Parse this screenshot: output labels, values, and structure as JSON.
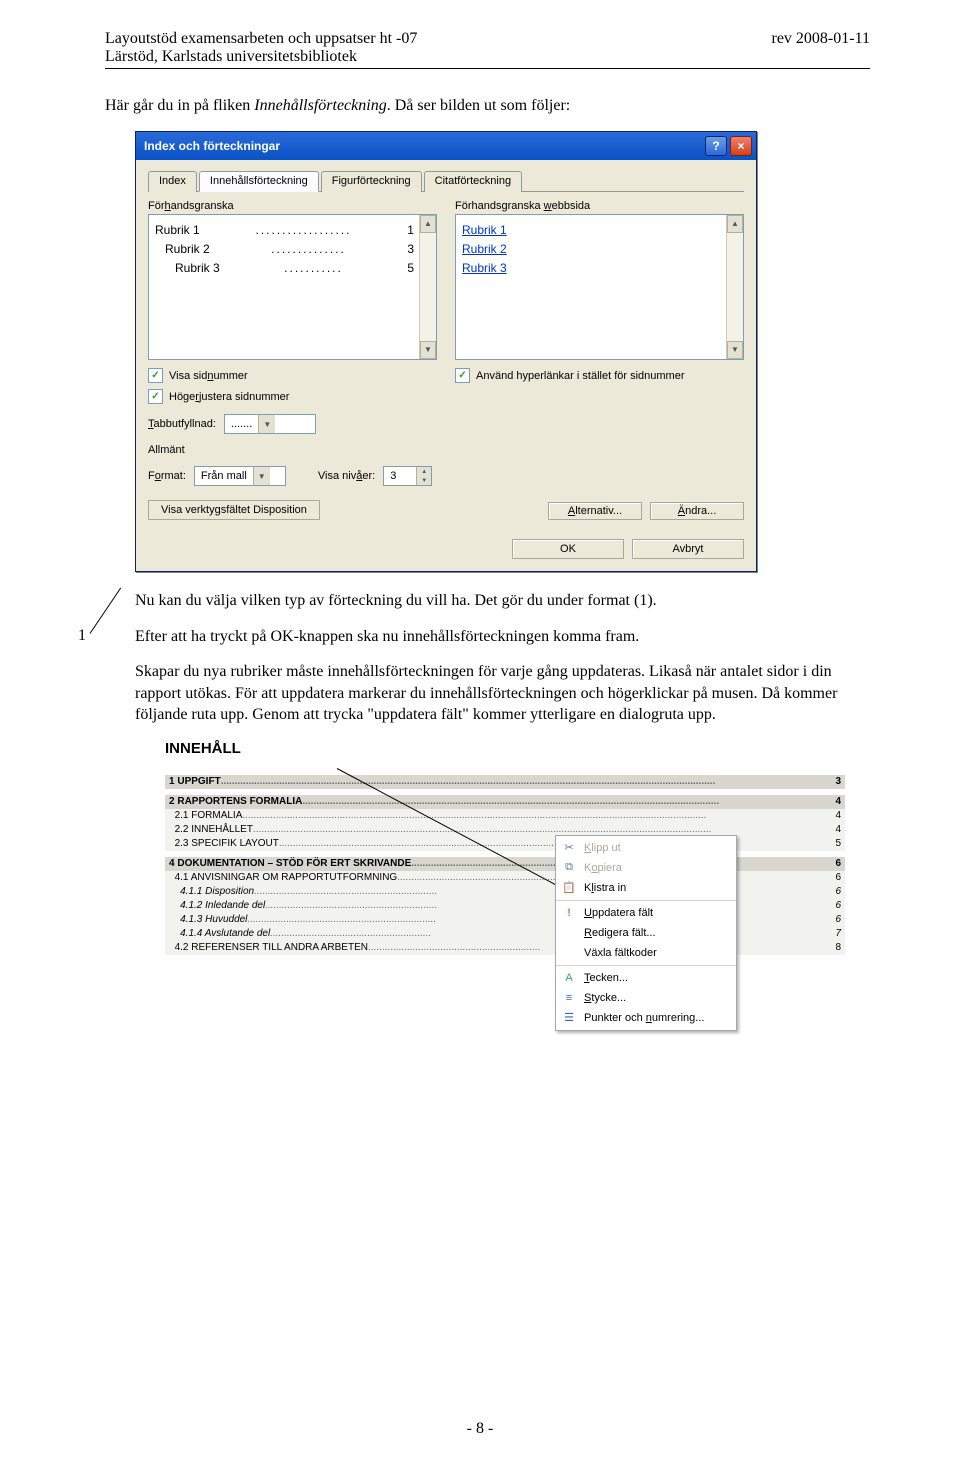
{
  "header": {
    "left1": "Layoutstöd examensarbeten och uppsatser ht -07",
    "left2": "Lärstöd, Karlstads universitetsbibliotek",
    "right": "rev 2008-01-11"
  },
  "intro_pre": "Här går du in på fliken ",
  "intro_italic": "Innehållsförteckning",
  "intro_post": ". Då ser bilden ut som följer:",
  "dialog": {
    "title": "Index och förteckningar",
    "help": "?",
    "close": "×",
    "tabs": [
      "Index",
      "Innehållsförteckning",
      "Figurförteckning",
      "Citatförteckning"
    ],
    "active_tab": 1,
    "preview_label": "Förhandsgranska",
    "webpreview_label": "Förhandsgranska webbsida",
    "preview_lines": [
      {
        "text": "Rubrik 1",
        "page": "1"
      },
      {
        "text": "   Rubrik 2",
        "page": "3"
      },
      {
        "text": "      Rubrik 3",
        "page": "5"
      }
    ],
    "web_lines": [
      "Rubrik 1",
      "   Rubrik 2",
      "      Rubrik 3"
    ],
    "chk_show_page": "Visa sidnummer",
    "chk_right_align": "Högerjustera sidnummer",
    "chk_hyperlinks": "Använd hyperlänkar i stället för sidnummer",
    "tab_leader_label": "Tabbutfyllnad:",
    "tab_leader_value": ".......",
    "section_general": "Allmänt",
    "format_label": "Format:",
    "format_value": "Från mall",
    "levels_label": "Visa nivåer:",
    "levels_value": "3",
    "outline_toolbar": "Visa verktygsfältet Disposition",
    "alt_btn": "Alternativ...",
    "modify_btn": "Ändra...",
    "ok": "OK",
    "cancel": "Avbryt"
  },
  "pointer1": "1",
  "paragraphs": {
    "p1": "Nu kan du välja vilken typ av förteckning du vill ha. Det gör du under format (1).",
    "p2": "Efter att ha tryckt på OK-knappen ska nu innehållsförteckningen komma fram.",
    "p3": "Skapar du nya rubriker måste innehållsförteckningen för varje gång uppdateras. Likaså när antalet sidor i din rapport utökas. För att uppdatera markerar du innehållsförteckningen och högerklickar på musen. Då kommer följande ruta upp. Genom att trycka \"uppdatera fält\" kommer ytterligare en dialogruta upp."
  },
  "toc": {
    "title": "INNEHÅLL",
    "rows": [
      {
        "lvl": 1,
        "num": "1",
        "text": "UPPGIFT",
        "page": "3",
        "hl": true
      },
      {
        "lvl": 1,
        "num": "2",
        "text": "RAPPORTENS FORMALIA",
        "page": "4",
        "hl": true
      },
      {
        "lvl": 2,
        "num": "2.1",
        "text": "FORMALIA",
        "page": "4"
      },
      {
        "lvl": 2,
        "num": "2.2",
        "text": "INNEHÅLLET",
        "page": "4"
      },
      {
        "lvl": 2,
        "num": "2.3",
        "text": "SPECIFIK LAYOUT",
        "page": "5"
      },
      {
        "lvl": 1,
        "num": "4",
        "text": "DOKUMENTATION – STÖD FÖR ERT SKRIVANDE",
        "page": "6",
        "hl": true
      },
      {
        "lvl": 2,
        "num": "4.1",
        "text": "ANVISNINGAR OM RAPPORTUTFORMNING",
        "page": "6"
      },
      {
        "lvl": 3,
        "num": "4.1.1",
        "text": "Disposition",
        "page": "6",
        "it": true
      },
      {
        "lvl": 3,
        "num": "4.1.2",
        "text": "Inledande del",
        "page": "6",
        "it": true
      },
      {
        "lvl": 3,
        "num": "4.1.3",
        "text": "Huvuddel",
        "page": "6",
        "it": true
      },
      {
        "lvl": 3,
        "num": "4.1.4",
        "text": "Avslutande del",
        "page": "7",
        "it": true
      },
      {
        "lvl": 2,
        "num": "4.2",
        "text": "REFERENSER TILL ANDRA ARBETEN",
        "page": "8"
      }
    ]
  },
  "ctx": {
    "cut": "Klipp ut",
    "copy": "Kopiera",
    "paste": "Klistra in",
    "update": "Uppdatera fält",
    "edit": "Redigera fält...",
    "toggle": "Växla fältkoder",
    "font": "Tecken...",
    "para": "Stycke...",
    "bullets": "Punkter och numrering..."
  },
  "footer": "- 8 -"
}
